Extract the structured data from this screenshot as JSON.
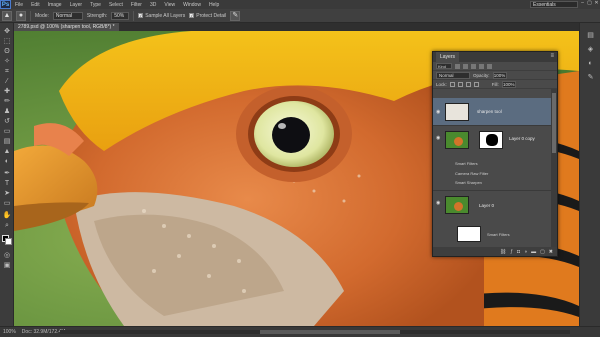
{
  "app": {
    "logo": "Ps"
  },
  "menu": [
    "File",
    "Edit",
    "Image",
    "Layer",
    "Type",
    "Select",
    "Filter",
    "3D",
    "View",
    "Window",
    "Help"
  ],
  "workspace": "Essentials",
  "window_controls": [
    "–",
    "▢",
    "✕"
  ],
  "options": {
    "mode_label": "Mode:",
    "mode_value": "Normal",
    "strength_label": "Strength:",
    "strength_value": "50%",
    "sample_all_layers": "Sample All Layers",
    "protect_detail": "Protect Detail"
  },
  "document": {
    "tab_title": "2789.psd @ 100% (sharpen tool, RGB/8*) *"
  },
  "status": {
    "zoom": "100%",
    "doc_size": "Doc: 32.9M/172.4M"
  },
  "layers_panel": {
    "tab": "Layers",
    "kind": "Kind",
    "blend_mode": "Normal",
    "opacity_label": "Opacity:",
    "opacity_value": "100%",
    "lock_label": "Lock:",
    "fill_label": "Fill:",
    "fill_value": "100%",
    "layers": [
      {
        "name": "sharpen tool",
        "selected": true
      },
      {
        "name": "Layer 0 copy",
        "selected": false,
        "sub": [
          "Smart Filters",
          "Camera Raw Filter",
          "Smart Sharpen"
        ]
      },
      {
        "name": "Layer 0",
        "selected": false,
        "sub": [
          "Smart Filters"
        ]
      }
    ],
    "footer_icons": [
      "link-icon",
      "fx-icon",
      "mask-icon",
      "adjustment-icon",
      "folder-icon",
      "new-layer-icon",
      "trash-icon"
    ]
  },
  "colors": {
    "accent": "#5b6c80",
    "panel": "#4a4a4a",
    "chrome": "#3a3a3a"
  }
}
